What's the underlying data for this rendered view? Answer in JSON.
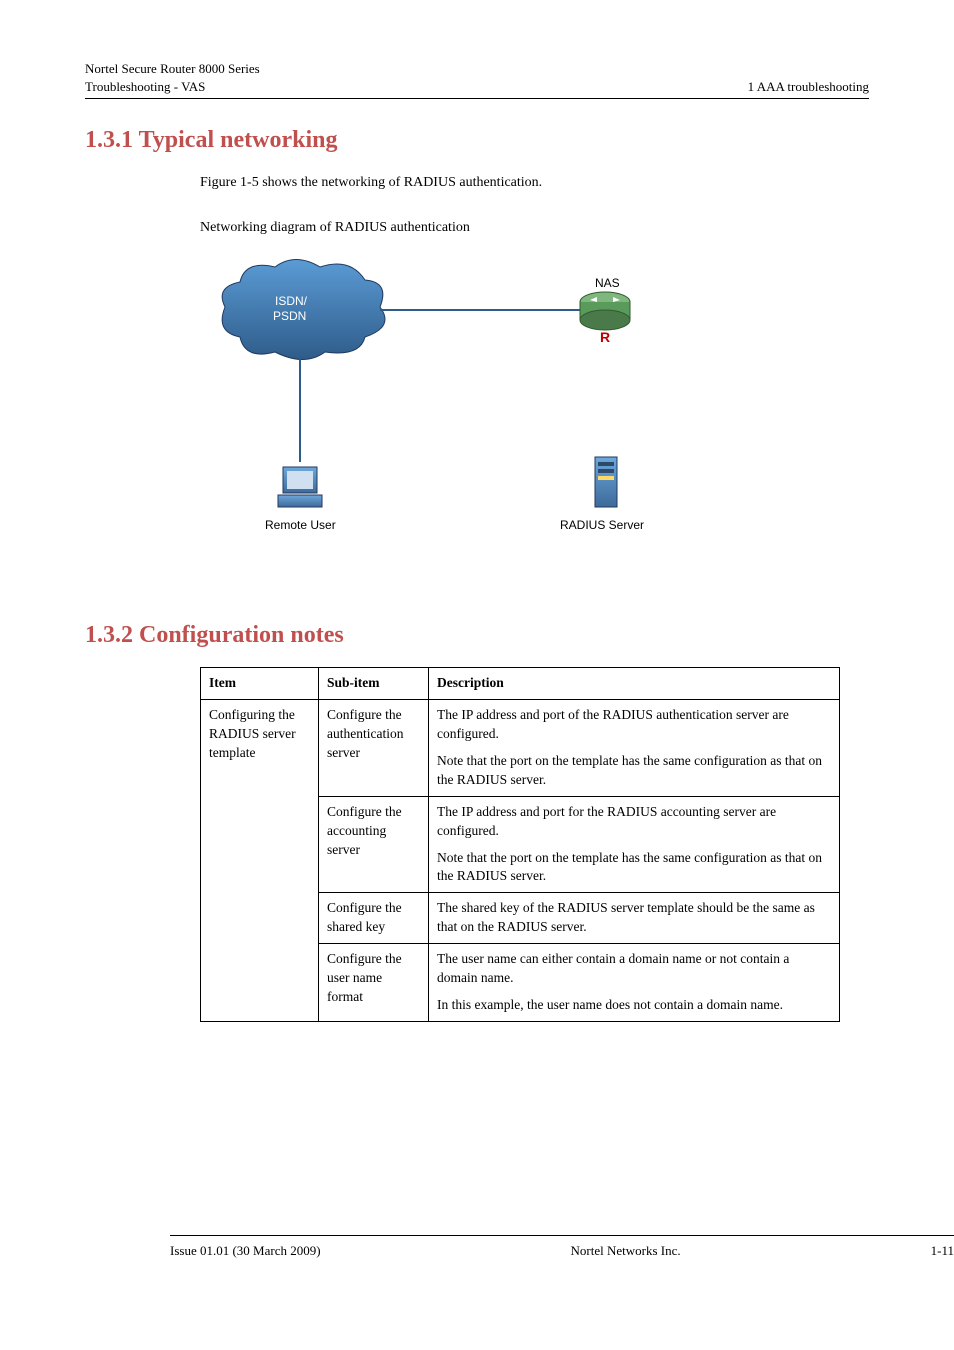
{
  "header": {
    "series": "Nortel Secure Router 8000 Series",
    "doc_title": "Troubleshooting - VAS",
    "chapter": "1 AAA troubleshooting"
  },
  "section1": {
    "heading": "1.3.1 Typical networking",
    "intro": "Figure 1-5 shows the networking of RADIUS authentication.",
    "figure_caption": "Networking diagram of RADIUS authentication",
    "diagram": {
      "cloud_label1": "ISDN/",
      "cloud_label2": "PSDN",
      "nas_label": "NAS",
      "router_label": "R",
      "remote_user": "Remote User",
      "radius_server": "RADIUS Server"
    }
  },
  "section2": {
    "heading": "1.3.2 Configuration notes",
    "columns": {
      "item": "Item",
      "sub_item": "Sub-item",
      "description": "Description"
    },
    "item1": "Configuring the RADIUS server template",
    "rows": [
      {
        "sub": "Configure the authentication server",
        "desc1": "The IP address and port of the RADIUS authentication server are configured.",
        "desc2": "Note that the port on the template has the same configuration as that on the RADIUS server."
      },
      {
        "sub": "Configure the accounting server",
        "desc1": "The IP address and port for the RADIUS accounting server are configured.",
        "desc2": "Note that the port on the template has the same configuration as that on the RADIUS server."
      },
      {
        "sub": "Configure the shared key",
        "desc1": "The shared key of the RADIUS server template should be the same as that on the RADIUS server."
      },
      {
        "sub": "Configure the user name format",
        "desc1": "The user name can either contain a domain name or not contain a domain name.",
        "desc2": "In this example, the user name does not contain a domain name."
      }
    ]
  },
  "footer": {
    "issue": "Issue 01.01 (30 March 2009)",
    "company": "Nortel Networks Inc.",
    "page": "1-11"
  }
}
